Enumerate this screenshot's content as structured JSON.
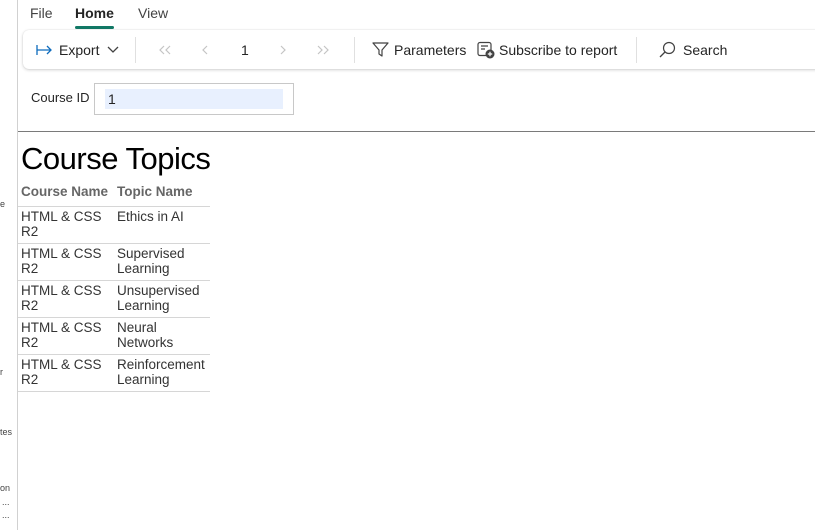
{
  "side_panel": {
    "fragments": [
      "e",
      "r",
      "tes",
      "on",
      "...",
      "..."
    ]
  },
  "menu": {
    "tabs": [
      {
        "label": "File"
      },
      {
        "label": "Home",
        "active": true
      },
      {
        "label": "View"
      }
    ]
  },
  "toolbar": {
    "export_label": "Export",
    "page_number": "1",
    "parameters_label": "Parameters",
    "subscribe_label": "Subscribe to report",
    "search_label": "Search"
  },
  "parameters": {
    "course_id_label": "Course ID",
    "course_id_value": "1"
  },
  "report": {
    "title": "Course Topics",
    "columns": [
      "Course Name",
      "Topic Name"
    ],
    "rows": [
      [
        "HTML & CSS R2",
        "Ethics in AI"
      ],
      [
        "HTML & CSS R2",
        "Supervised Learning"
      ],
      [
        "HTML & CSS R2",
        "Unsupervised Learning"
      ],
      [
        "HTML & CSS R2",
        "Neural Networks"
      ],
      [
        "HTML & CSS R2",
        "Reinforcement Learning"
      ]
    ]
  },
  "colors": {
    "accent": "#117865",
    "input_highlight": "#e8f0fe"
  }
}
